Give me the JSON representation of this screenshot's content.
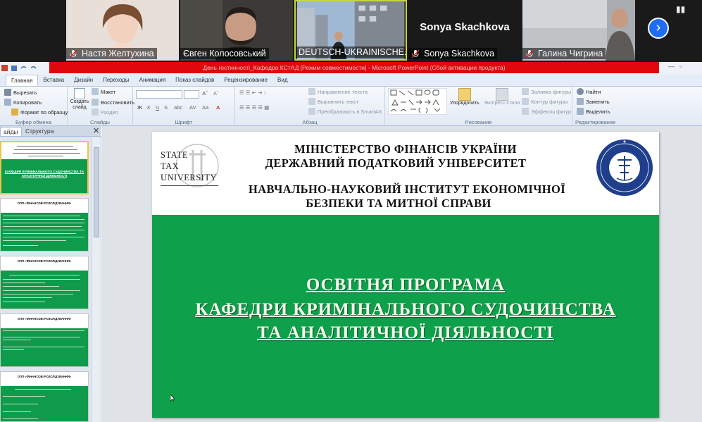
{
  "zoom": {
    "participants": [
      {
        "name": "Настя Желтухина",
        "muted": true
      },
      {
        "name": "Євген Колосовський",
        "muted": false
      },
      {
        "name": "DEUTSCH-UKRAINISCHE...",
        "muted": false
      },
      {
        "name": "Sonya Skachkova",
        "muted": true,
        "big_label": "Sonya Skachkova"
      },
      {
        "name": "Галина Чигрина",
        "muted": true
      }
    ]
  },
  "window": {
    "title": "День гостинності_Кафедра КСтАД [Режим совместимости] - Microsoft PowerPoint (Сбой активации продукта)"
  },
  "ribbon": {
    "tabs": [
      "Главная",
      "Вставка",
      "Дизайн",
      "Переходы",
      "Анимация",
      "Показ слайдов",
      "Рецензирование",
      "Вид"
    ],
    "clipboard": {
      "cut": "Вырезать",
      "copy": "Копировать",
      "format": "Формат по образцу",
      "label": "Буфер обмена"
    },
    "slides": {
      "new": "Создать слайд",
      "layout": "Макет",
      "reset": "Восстановить",
      "section": "Раздел",
      "label": "Слайды"
    },
    "font": {
      "label": "Шрифт"
    },
    "paragraph": {
      "direction": "Направление текста",
      "align": "Выровнять текст",
      "smartart": "Преобразовать в SmartArt",
      "label": "Абзац"
    },
    "drawing": {
      "arrange": "Упорядочить",
      "styles": "Экспресс-стили",
      "fill": "Заливка фигуры",
      "outline": "Контур фигуры",
      "effects": "Эффекты фигур",
      "label": "Рисование"
    },
    "editing": {
      "find": "Найти",
      "replace": "Заменить",
      "select": "Выделить",
      "label": "Редактирование"
    }
  },
  "panel": {
    "tabs": [
      "айды",
      "Структура"
    ],
    "thumbs": [
      {
        "title": "КАФЕДРИ КРИМІНАЛЬНОГО СУДОЧИНСТВА ТА АНАЛІТИЧНОЇ ДІЯЛЬНОСТІ"
      },
      {
        "title": "ОПП «ФІНАНСОВІ РОЗСЛІДУВАННЯ»"
      },
      {
        "title": "ОПП «ФІНАНСОВІ РОЗСЛІДУВАННЯ»"
      },
      {
        "title": "ОПП «ФІНАНСОВІ РОЗСЛІДУВАННЯ»"
      },
      {
        "title": "ОПП «ФІНАНСОВІ РОЗСЛІДУВАННЯ»"
      }
    ]
  },
  "slide": {
    "logo_words": [
      "STATE",
      "TAX",
      "UNIVERSITY"
    ],
    "header": [
      "МІНІСТЕРСТВО ФІНАНСІВ УКРАЇНИ",
      "ДЕРЖАВНИЙ ПОДАТКОВИЙ УНІВЕРСИТЕТ",
      "НАВЧАЛЬНО-НАУКОВИЙ ІНСТИТУТ ЕКОНОМІЧНОЇ",
      "БЕЗПЕКИ ТА МИТНОЇ СПРАВИ"
    ],
    "body": [
      "ОСВІТНЯ ПРОГРАМА",
      "КАФЕДРИ КРИМІНАЛЬНОГО СУДОЧИНСТВА",
      "ТА АНАЛІТИЧНОЇ ДІЯЛЬНОСТІ"
    ]
  },
  "colors": {
    "slide_green": "#0fa04c",
    "title_red": "#e0080c",
    "zoom_blue": "#1f6df0"
  }
}
